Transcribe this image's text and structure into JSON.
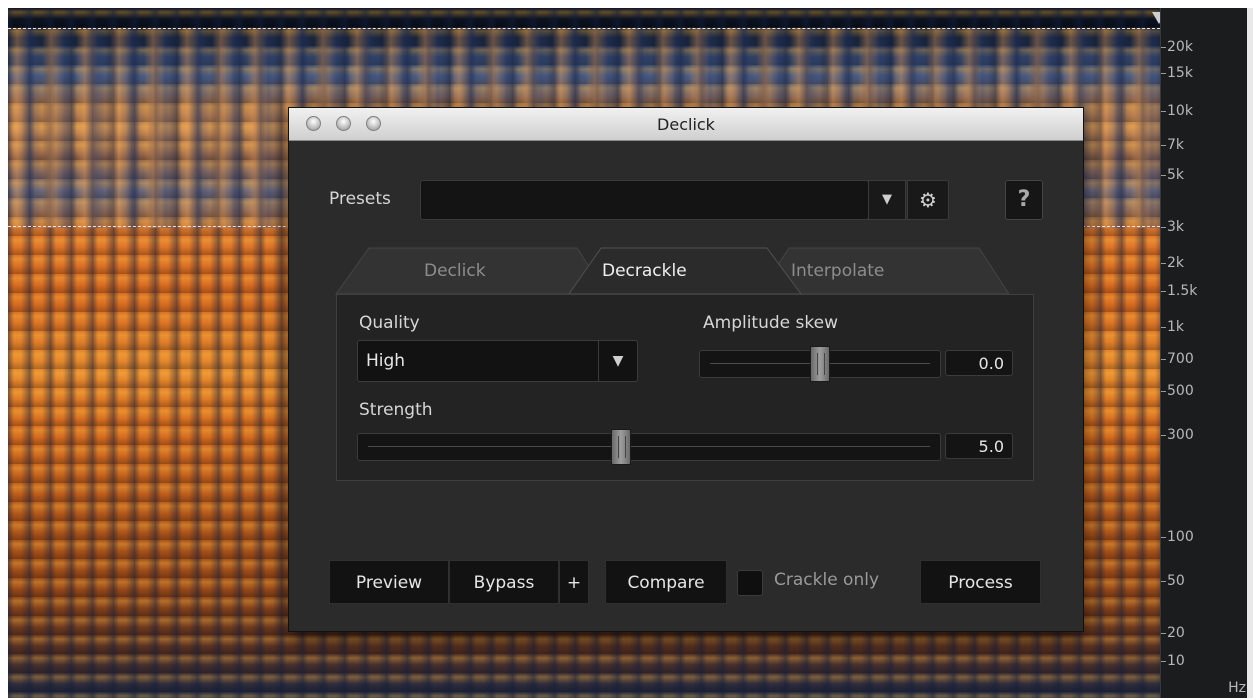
{
  "dialog": {
    "title": "Declick",
    "presets_label": "Presets",
    "presets_value": "",
    "help_label": "?",
    "tabs": [
      {
        "label": "Declick",
        "active": false
      },
      {
        "label": "Decrackle",
        "active": true
      },
      {
        "label": "Interpolate",
        "active": false
      }
    ],
    "quality_label": "Quality",
    "quality_value": "High",
    "amplitude_skew_label": "Amplitude skew",
    "amplitude_skew_value": "0.0",
    "amplitude_skew_fraction": 0.5,
    "strength_label": "Strength",
    "strength_value": "5.0",
    "strength_fraction": 0.45,
    "buttons": {
      "preview": "Preview",
      "bypass": "Bypass",
      "plus": "+",
      "compare": "Compare",
      "crackle_only": "Crackle only",
      "process": "Process"
    },
    "crackle_only_checked": false
  },
  "ruler": {
    "ticks": [
      "20k",
      "15k",
      "10k",
      "7k",
      "5k",
      "3k",
      "2k",
      "1.5k",
      "1k",
      "700",
      "500",
      "300",
      "100",
      "50",
      "20",
      "10"
    ],
    "unit": "Hz"
  },
  "colors": {
    "dialog_bg": "#2b2b2b",
    "spectrogram_accent": "#e0772a"
  }
}
